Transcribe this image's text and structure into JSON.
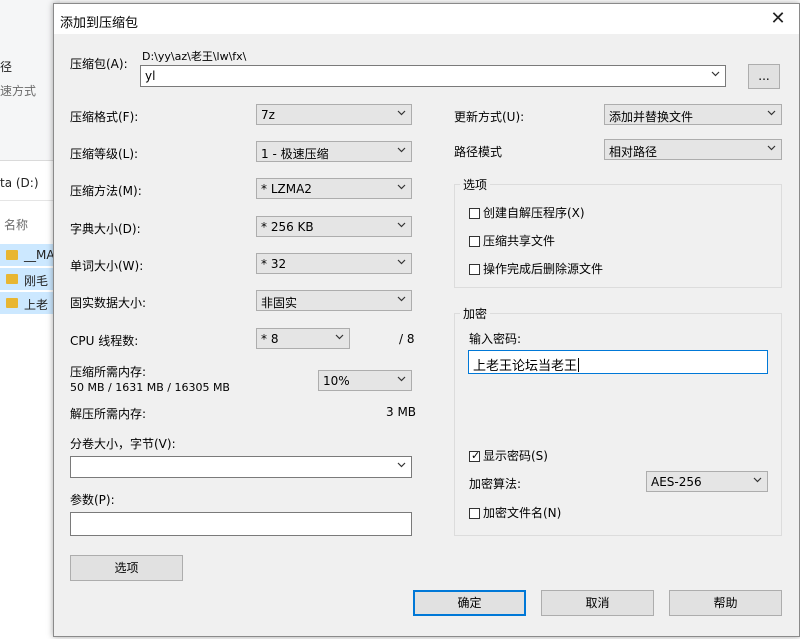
{
  "background": {
    "ribbon_items": [
      "径",
      "速方式"
    ],
    "address": "ta (D:)",
    "column_header": "名称",
    "files": [
      "__MA",
      "刚毛",
      "上老"
    ]
  },
  "dialog": {
    "title": "添加到压缩包",
    "close_glyph": "✕",
    "archive": {
      "label": "压缩包(A):",
      "path": "D:\\yy\\az\\老王\\lw\\fx\\",
      "name": "yl",
      "browse_label": "..."
    },
    "left": {
      "format": {
        "label": "压缩格式(F):",
        "value": "7z"
      },
      "level": {
        "label": "压缩等级(L):",
        "value": "1 - 极速压缩"
      },
      "method": {
        "label": "压缩方法(M):",
        "value": "* LZMA2"
      },
      "dict": {
        "label": "字典大小(D):",
        "value": "* 256 KB"
      },
      "word": {
        "label": "单词大小(W):",
        "value": "* 32"
      },
      "solid": {
        "label": "固实数据大小:",
        "value": "非固实"
      },
      "cpu": {
        "label": "CPU 线程数:",
        "value": "* 8",
        "max": "/ 8"
      },
      "mem_compress": {
        "label": "压缩所需内存:",
        "detail": "50 MB / 1631 MB / 16305 MB",
        "value": "10%"
      },
      "mem_decompress": {
        "label": "解压所需内存:",
        "value": "3 MB"
      },
      "volume": {
        "label": "分卷大小，字节(V):",
        "value": ""
      },
      "params": {
        "label": "参数(P):",
        "value": ""
      },
      "options_button": "选项"
    },
    "right": {
      "update": {
        "label": "更新方式(U):",
        "value": "添加并替换文件"
      },
      "path_mode": {
        "label": "路径模式",
        "value": "相对路径"
      },
      "options_group": {
        "title": "选项",
        "items": [
          {
            "label": "创建自解压程序(X)",
            "checked": false
          },
          {
            "label": "压缩共享文件",
            "checked": false
          },
          {
            "label": "操作完成后删除源文件",
            "checked": false
          }
        ]
      },
      "encrypt_group": {
        "title": "加密",
        "password_label": "输入密码:",
        "password": "上老王论坛当老王",
        "show_password": {
          "label": "显示密码(S)",
          "checked": true
        },
        "method_label": "加密算法:",
        "method_value": "AES-256",
        "encrypt_names": {
          "label": "加密文件名(N)",
          "checked": false
        }
      }
    },
    "buttons": {
      "ok": "确定",
      "cancel": "取消",
      "help": "帮助"
    }
  },
  "colors": {
    "focus_blue": "#0078d7",
    "dialog_bg": "#f0f0f0",
    "selection": "#cce8ff"
  }
}
